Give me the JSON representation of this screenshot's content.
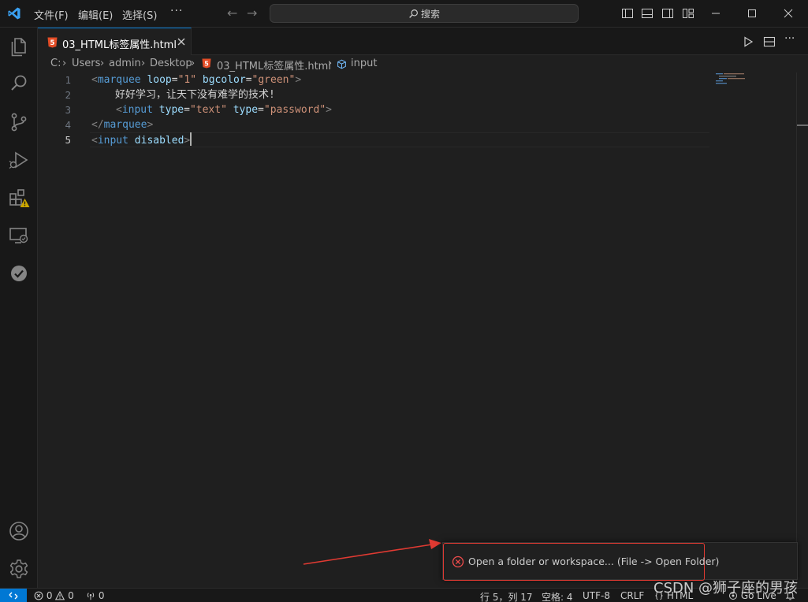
{
  "menu": {
    "file": "文件(F)",
    "edit": "编辑(E)",
    "selection": "选择(S)",
    "more": "···"
  },
  "search": {
    "label": "搜索"
  },
  "tab": {
    "title": "03_HTML标签属性.html"
  },
  "breadcrumb": {
    "drive": "C:",
    "users": "Users",
    "admin": "admin",
    "desktop": "Desktop",
    "file": "03_HTML标签属性.html",
    "symbol": "input"
  },
  "editor": {
    "line_numbers": [
      "1",
      "2",
      "3",
      "4",
      "5"
    ],
    "line1": {
      "open": "<",
      "tag": "marquee",
      "attr1": "loop",
      "eq1": "=",
      "val1": "\"1\"",
      "attr2": "bgcolor",
      "eq2": "=",
      "val2": "\"green\"",
      "close": ">"
    },
    "line2": {
      "text": "好好学习，让天下没有难学的技术!"
    },
    "line3": {
      "open": "<",
      "tag": "input",
      "attr1": "type",
      "eq1": "=",
      "val1": "\"text\"",
      "attr2": "type",
      "eq2": "=",
      "val2": "\"password\"",
      "close": ">"
    },
    "line4": {
      "open": "</",
      "tag": "marquee",
      "close": ">"
    },
    "line5": {
      "open": "<",
      "tag": "input",
      "attr1": "disabled",
      "close": ">"
    }
  },
  "notification": {
    "message": "Open a folder or workspace... (File -> Open Folder)"
  },
  "status": {
    "errors": "0",
    "warnings": "0",
    "ports": "0",
    "position": "行 5，列 17",
    "spaces": "空格: 4",
    "encoding": "UTF-8",
    "eol": "CRLF",
    "language": "HTML",
    "golive": "Go Live"
  },
  "watermark": "CSDN @狮子座的男孩",
  "colors": {
    "accent": "#0078d4",
    "error": "#f14c4c",
    "annotation_red": "#e03a32",
    "warning_badge": "#cca700"
  }
}
